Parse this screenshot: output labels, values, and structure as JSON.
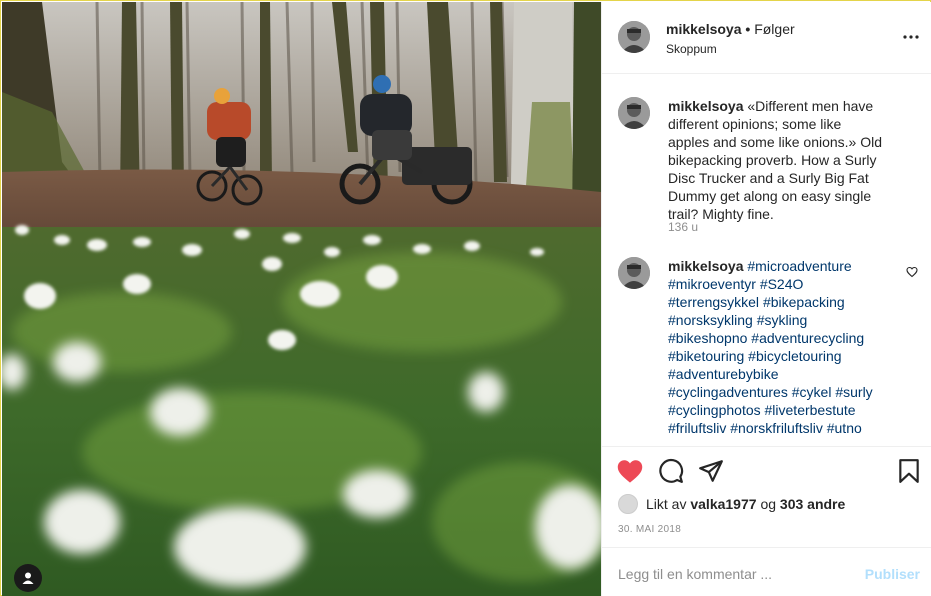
{
  "post": {
    "username": "mikkelsoya",
    "separator": "•",
    "follow_label": "Følger",
    "location": "Skoppum",
    "more_icon": "more-options-icon"
  },
  "comments": [
    {
      "username": "mikkelsoya",
      "text": "«Different men have different opinions; some like apples and some like onions.» Old bikepacking proverb. How a Surly Disc Trucker and a Surly Big Fat Dummy get along on easy single trail? Mighty fine.",
      "age": "136 u"
    },
    {
      "username": "mikkelsoya",
      "hashtags": [
        "#microadventure",
        "#mikroeventyr",
        "#S24O",
        "#terrengsykkel",
        "#bikepacking",
        "#norsksykling",
        "#sykling",
        "#bikeshopno",
        "#adventurecycling",
        "#biketouring",
        "#bicycletouring",
        "#adventurebybike",
        "#cyclingadventures",
        "#cykel",
        "#surly",
        "#cyclingphotos",
        "#liveterbestute",
        "#friluftsliv",
        "#norskfriluftsliv",
        "#utno"
      ]
    }
  ],
  "actions": {
    "like_icon": "heart-filled-icon",
    "like_color": "#ed4956",
    "comment_icon": "comment-icon",
    "share_icon": "share-icon",
    "save_icon": "bookmark-icon"
  },
  "likes": {
    "prefix": "Likt av",
    "user": "valka1977",
    "joiner": "og",
    "others": "303 andre"
  },
  "date": "30. MAI 2018",
  "add_comment": {
    "placeholder": "Legg til en kommentar ...",
    "post_label": "Publiser"
  }
}
